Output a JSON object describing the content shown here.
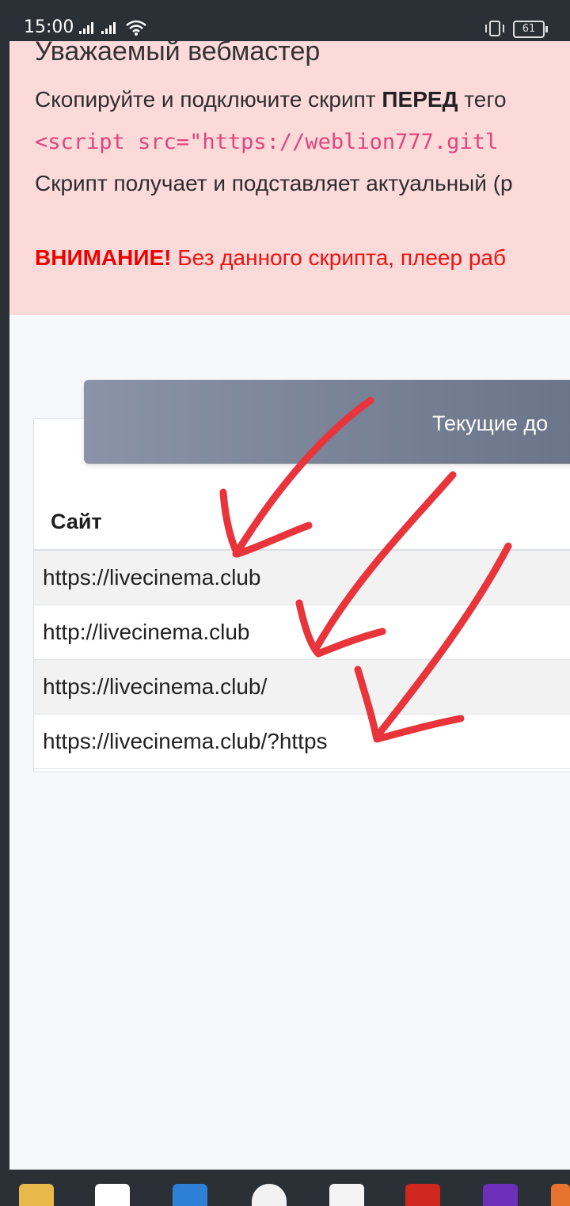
{
  "status_bar": {
    "time": "15:00",
    "battery": "61"
  },
  "alert": {
    "heading": "Уважаемый вебмастер",
    "line1_prefix": "Скопируйте и подключите скрипт ",
    "line1_bold": "ПЕРЕД",
    "line1_suffix": " тего",
    "code": "<script src=\"https://weblion777.gitl",
    "line2": "Скрипт получает и подставляет актуальный (р",
    "warning_bold": "ВНИМАНИЕ!",
    "warning_text": " Без данного скрипта, плеер раб"
  },
  "card": {
    "header_title": "Текущие до",
    "column_header": "Сайт",
    "rows": [
      "https://livecinema.club",
      "http://livecinema.club",
      "https://livecinema.club/",
      "https://livecinema.club/?https"
    ]
  },
  "colors": {
    "alert_bg": "#fcdada",
    "code_pink": "#e0457b",
    "warning_red": "#ee1111",
    "annotation_red": "#e8343a",
    "header_grad_start": "#8a93a8",
    "header_grad_end": "#6a7488"
  },
  "taskbar_icons": [
    "folder-icon",
    "store-icon",
    "mail-icon",
    "yandex-icon",
    "docs-icon",
    "html5-icon",
    "app-icon",
    "orange-app-icon"
  ]
}
